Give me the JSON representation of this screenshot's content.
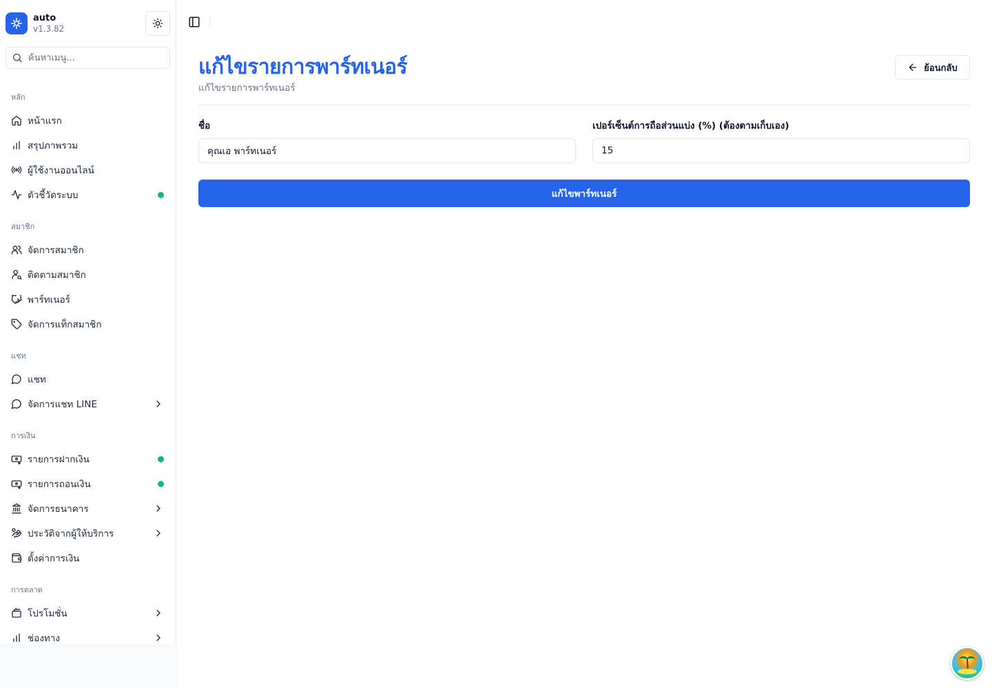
{
  "brand": {
    "name": "auto",
    "version": "v1.3.82"
  },
  "search": {
    "placeholder": "ค้นหาเมนู..."
  },
  "sidebar": {
    "groups": [
      {
        "label": "หลัก"
      },
      {
        "label": "สมาชิก"
      },
      {
        "label": "แชท"
      },
      {
        "label": "การเงิน"
      },
      {
        "label": "การตลาด"
      }
    ],
    "items": [
      {
        "label": "หน้าแรก",
        "icon": "home-icon"
      },
      {
        "label": "สรุปภาพรวม",
        "icon": "bar-chart-icon"
      },
      {
        "label": "ผู้ใช้งานออนไลน์",
        "icon": "radio-icon",
        "status": "online"
      },
      {
        "label": "ตัวชี้วัดระบบ",
        "icon": "activity-icon"
      },
      {
        "label": "จัดการสมาชิก",
        "icon": "users-icon"
      },
      {
        "label": "ติดตามสมาชิก",
        "icon": "user-search-icon"
      },
      {
        "label": "พาร์ทเนอร์",
        "icon": "handshake-icon"
      },
      {
        "label": "จัดการแท็กสมาชิก",
        "icon": "tag-icon"
      },
      {
        "label": "แชท",
        "icon": "message-circle-icon"
      },
      {
        "label": "จัดการแชท LINE",
        "icon": "message-circle-icon"
      },
      {
        "label": "รายการฝากเงิน",
        "icon": "deposit-icon"
      },
      {
        "label": "รายการถอนเงิน",
        "icon": "withdraw-icon"
      },
      {
        "label": "จัดการธนาคาร",
        "icon": "bank-icon"
      },
      {
        "label": "ประวัติจากผู้ให้บริการ",
        "icon": "hand-coins-icon"
      },
      {
        "label": "ตั้งค่าการเงิน",
        "icon": "wallet-icon"
      },
      {
        "label": "โปรโมชั่น",
        "icon": "promotion-icon"
      },
      {
        "label": "ช่องทาง",
        "icon": "bar-chart-icon"
      }
    ]
  },
  "page": {
    "title": "แก้ไขรายการพาร์ทเนอร์",
    "subtitle": "แก้ไขรายการพาร์ทเนอร์",
    "back_label": "ย้อนกลับ"
  },
  "form": {
    "name_label": "ชื่อ",
    "name_value": "คุณเอ พาร์ทเนอร์",
    "percent_label": "เปอร์เซ็นต์การถือส่วนแบ่ง (%) (ต้องตามเก็บเอง)",
    "percent_value": "15",
    "submit_label": "แก้ไขพาร์ทเนอร์"
  },
  "colors": {
    "accent": "#2563eb",
    "status_dot": "#10b981",
    "border": "#e5e7eb",
    "muted_text": "#64748b"
  }
}
